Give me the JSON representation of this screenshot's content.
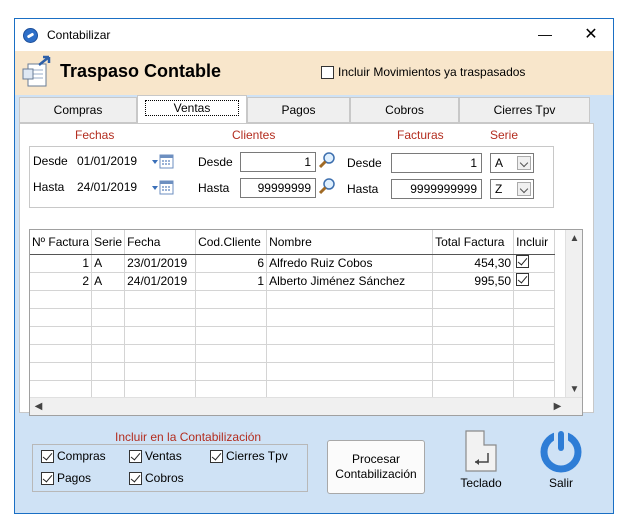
{
  "window": {
    "title": "Contabilizar",
    "minimize": "—",
    "close": "✕"
  },
  "header": {
    "title": "Traspaso Contable",
    "include_moved_label": "Incluir Movimientos ya traspasados",
    "include_moved_checked": false
  },
  "tabs": [
    {
      "label": "Compras",
      "active": false
    },
    {
      "label": "Ventas",
      "active": true
    },
    {
      "label": "Pagos",
      "active": false
    },
    {
      "label": "Cobros",
      "active": false
    },
    {
      "label": "Cierres Tpv",
      "active": false
    }
  ],
  "filters": {
    "fechas_title": "Fechas",
    "clientes_title": "Clientes",
    "facturas_title": "Facturas",
    "serie_title": "Serie",
    "desde_label": "Desde",
    "hasta_label": "Hasta",
    "fecha_desde": "01/01/2019",
    "fecha_hasta": "24/01/2019",
    "cliente_desde": "1",
    "cliente_hasta": "99999999",
    "factura_desde": "1",
    "factura_hasta": "9999999999",
    "serie_desde": "A",
    "serie_hasta": "Z"
  },
  "table": {
    "columns": [
      "Nº Factura",
      "Serie",
      "Fecha",
      "Cod.Cliente",
      "Nombre",
      "Total Factura",
      "Incluir"
    ],
    "rows": [
      {
        "factura": "1",
        "serie": "A",
        "fecha": "23/01/2019",
        "cliente": "6",
        "nombre": "Alfredo Ruiz Cobos",
        "total": "454,30",
        "incluir": true
      },
      {
        "factura": "2",
        "serie": "A",
        "fecha": "24/01/2019",
        "cliente": "1",
        "nombre": "Alberto Jiménez Sánchez",
        "total": "995,50",
        "incluir": true
      }
    ]
  },
  "contabilizacion": {
    "title": "Incluir en la Contabilización",
    "options": [
      {
        "label": "Compras",
        "checked": true
      },
      {
        "label": "Ventas",
        "checked": true
      },
      {
        "label": "Cierres Tpv",
        "checked": true
      },
      {
        "label": "Pagos",
        "checked": true
      },
      {
        "label": "Cobros",
        "checked": true
      }
    ]
  },
  "actions": {
    "procesar_line1": "Procesar",
    "procesar_line2": "Contabilización",
    "teclado": "Teclado",
    "salir": "Salir"
  },
  "colors": {
    "accent": "#b32d1f",
    "header_bg": "#f8e6cb",
    "window_bg": "#cfe2f5",
    "border": "#1a6fc4"
  }
}
